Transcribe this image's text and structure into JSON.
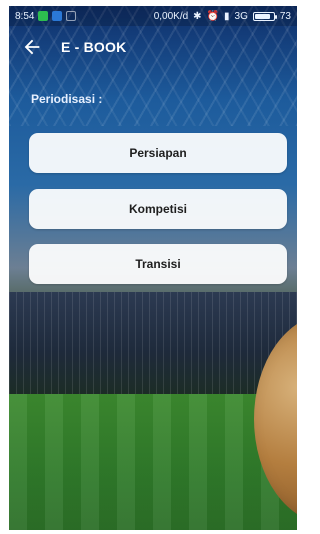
{
  "status_bar": {
    "time": "8:54",
    "network_speed": "0,00K/d",
    "network_type": "3G",
    "battery": "73"
  },
  "appbar": {
    "title": "E - BOOK",
    "back_icon": "arrow-left-icon"
  },
  "section": {
    "label": "Periodisasi :"
  },
  "buttons": [
    {
      "label": "Persiapan"
    },
    {
      "label": "Kompetisi"
    },
    {
      "label": "Transisi"
    }
  ]
}
